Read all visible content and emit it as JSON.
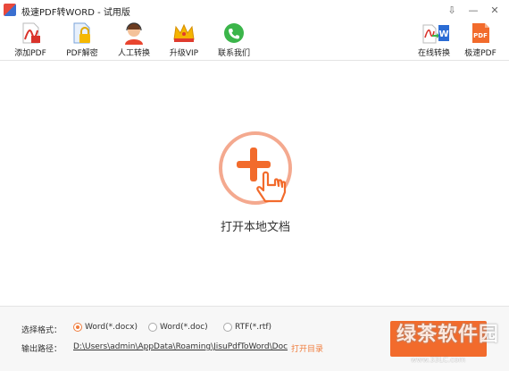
{
  "window": {
    "title": "极速PDF转WORD - 试用版",
    "controls": [
      "⇩",
      "—",
      "✕"
    ]
  },
  "toolbar": {
    "add_pdf": "添加PDF",
    "pdf_decrypt": "PDF解密",
    "manual_convert": "人工转换",
    "upgrade_vip": "升级VIP",
    "contact_us": "联系我们",
    "online_convert": "在线转换",
    "jisu_pdf": "极速PDF",
    "jisu_pdf_icon_text": "PDF",
    "online_convert_icon_text": "W"
  },
  "main": {
    "open_local_doc": "打开本地文档"
  },
  "options": {
    "format_label": "选择格式：",
    "formats": [
      "Word(*.docx)",
      "Word(*.doc)",
      "RTF(*.rtf)"
    ],
    "selected_format": "Word(*.docx)",
    "output_label": "输出路径：",
    "output_path": "D:\\Users\\admin\\AppData\\Roaming\\JisuPdfToWord\\Doc",
    "open_dir": "打开目录"
  },
  "watermark": {
    "text": "绿茶软件园",
    "url": "www.33LC.com"
  },
  "colors": {
    "accent": "#f26b2c",
    "open_circle": "#f4a98f"
  }
}
